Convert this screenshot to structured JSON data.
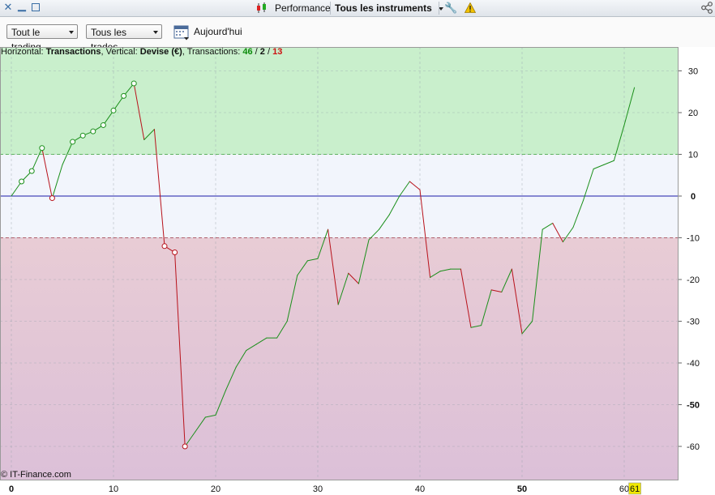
{
  "window": {
    "title_label": "Performance",
    "instrument_label": "Tous les instruments",
    "controls": [
      "close-icon",
      "minimize-icon",
      "maximize-icon"
    ]
  },
  "toolbar": {
    "trading_filter": "Tout le trading",
    "trades_filter": "Tous les trades",
    "date_label": "Aujourd'hui"
  },
  "header": {
    "prefix": "Horizontal: ",
    "h_value": "Transactions",
    "mid": ", Vertical: ",
    "v_value": "Devise (€)",
    "tx_prefix": ", Transactions: ",
    "tx_win": "46",
    "slash1": " / ",
    "tx_neutral": "2",
    "slash2": " / ",
    "tx_loss": "13"
  },
  "credit": "© IT-Finance.com",
  "colors": {
    "gain": "#1a8f1a",
    "loss": "#b8121b",
    "zero_line": "#1c1ca8",
    "zone_top": "#c9efcc",
    "zone_mid": "#f2f5fc",
    "zone_bottom_top": "#e8ccd5",
    "zone_bottom_bottom": "#dcc0d8"
  },
  "chart_data": {
    "type": "line",
    "xlim": [
      -1,
      65
    ],
    "ylim": [
      -68,
      36
    ],
    "x_ticks": [
      0,
      10,
      20,
      30,
      40,
      50,
      60
    ],
    "x_ticks_bold": [
      0,
      50
    ],
    "x_highlight": 61,
    "y_ticks": [
      30,
      20,
      10,
      0,
      -10,
      -20,
      -30,
      -40,
      -50,
      -60
    ],
    "y_ticks_bold": [
      0,
      -50
    ],
    "zone_upper": 10,
    "zone_lower": -10,
    "series": [
      {
        "values": [
          0,
          3.5,
          6,
          11.5,
          -0.5,
          7.5,
          13,
          14.5,
          15.5,
          17,
          20.5,
          24,
          27,
          13.5,
          16,
          -12,
          -13.5,
          -60,
          -56.5,
          -53,
          -52.5,
          -46.5,
          -41,
          -37,
          -35.5,
          -34,
          -34,
          -30,
          -19,
          -15.5,
          -15,
          -8,
          -26,
          -18.5,
          -21,
          -10.5,
          -8,
          -4.5,
          0,
          3.5,
          1.5,
          -19.5,
          -18,
          -17.5,
          -17.5,
          -31.5,
          -31,
          -22.5,
          -23,
          -17.5,
          -33,
          -30,
          -8,
          -6.5,
          -11,
          -7.5,
          -1,
          6.5,
          7.5,
          8.5,
          17,
          26
        ],
        "markers": [
          1,
          2,
          3,
          4,
          6,
          7,
          8,
          9,
          10,
          11,
          12,
          15,
          16,
          17
        ]
      }
    ]
  }
}
